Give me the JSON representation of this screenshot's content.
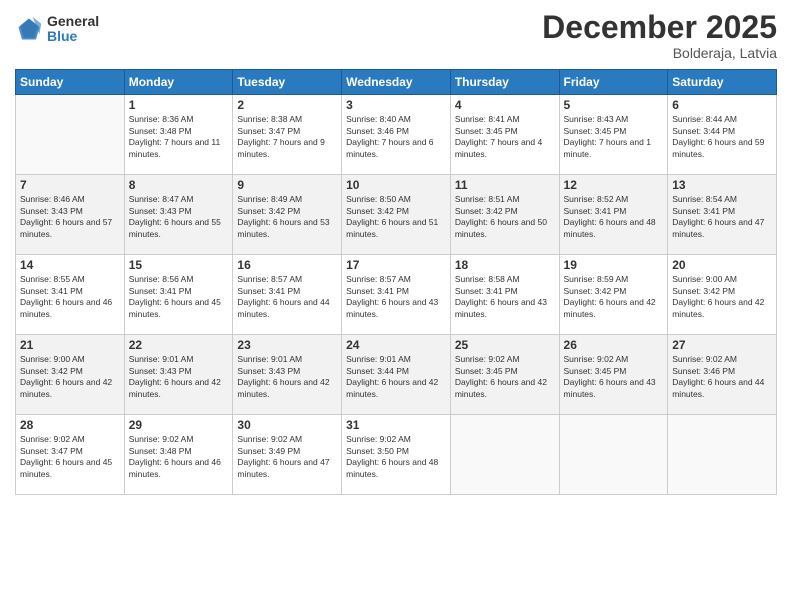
{
  "logo": {
    "general": "General",
    "blue": "Blue"
  },
  "title": "December 2025",
  "subtitle": "Bolderaja, Latvia",
  "headers": [
    "Sunday",
    "Monday",
    "Tuesday",
    "Wednesday",
    "Thursday",
    "Friday",
    "Saturday"
  ],
  "weeks": [
    [
      {
        "day": "",
        "sunrise": "",
        "sunset": "",
        "daylight": ""
      },
      {
        "day": "1",
        "sunrise": "Sunrise: 8:36 AM",
        "sunset": "Sunset: 3:48 PM",
        "daylight": "Daylight: 7 hours and 11 minutes."
      },
      {
        "day": "2",
        "sunrise": "Sunrise: 8:38 AM",
        "sunset": "Sunset: 3:47 PM",
        "daylight": "Daylight: 7 hours and 9 minutes."
      },
      {
        "day": "3",
        "sunrise": "Sunrise: 8:40 AM",
        "sunset": "Sunset: 3:46 PM",
        "daylight": "Daylight: 7 hours and 6 minutes."
      },
      {
        "day": "4",
        "sunrise": "Sunrise: 8:41 AM",
        "sunset": "Sunset: 3:45 PM",
        "daylight": "Daylight: 7 hours and 4 minutes."
      },
      {
        "day": "5",
        "sunrise": "Sunrise: 8:43 AM",
        "sunset": "Sunset: 3:45 PM",
        "daylight": "Daylight: 7 hours and 1 minute."
      },
      {
        "day": "6",
        "sunrise": "Sunrise: 8:44 AM",
        "sunset": "Sunset: 3:44 PM",
        "daylight": "Daylight: 6 hours and 59 minutes."
      }
    ],
    [
      {
        "day": "7",
        "sunrise": "Sunrise: 8:46 AM",
        "sunset": "Sunset: 3:43 PM",
        "daylight": "Daylight: 6 hours and 57 minutes."
      },
      {
        "day": "8",
        "sunrise": "Sunrise: 8:47 AM",
        "sunset": "Sunset: 3:43 PM",
        "daylight": "Daylight: 6 hours and 55 minutes."
      },
      {
        "day": "9",
        "sunrise": "Sunrise: 8:49 AM",
        "sunset": "Sunset: 3:42 PM",
        "daylight": "Daylight: 6 hours and 53 minutes."
      },
      {
        "day": "10",
        "sunrise": "Sunrise: 8:50 AM",
        "sunset": "Sunset: 3:42 PM",
        "daylight": "Daylight: 6 hours and 51 minutes."
      },
      {
        "day": "11",
        "sunrise": "Sunrise: 8:51 AM",
        "sunset": "Sunset: 3:42 PM",
        "daylight": "Daylight: 6 hours and 50 minutes."
      },
      {
        "day": "12",
        "sunrise": "Sunrise: 8:52 AM",
        "sunset": "Sunset: 3:41 PM",
        "daylight": "Daylight: 6 hours and 48 minutes."
      },
      {
        "day": "13",
        "sunrise": "Sunrise: 8:54 AM",
        "sunset": "Sunset: 3:41 PM",
        "daylight": "Daylight: 6 hours and 47 minutes."
      }
    ],
    [
      {
        "day": "14",
        "sunrise": "Sunrise: 8:55 AM",
        "sunset": "Sunset: 3:41 PM",
        "daylight": "Daylight: 6 hours and 46 minutes."
      },
      {
        "day": "15",
        "sunrise": "Sunrise: 8:56 AM",
        "sunset": "Sunset: 3:41 PM",
        "daylight": "Daylight: 6 hours and 45 minutes."
      },
      {
        "day": "16",
        "sunrise": "Sunrise: 8:57 AM",
        "sunset": "Sunset: 3:41 PM",
        "daylight": "Daylight: 6 hours and 44 minutes."
      },
      {
        "day": "17",
        "sunrise": "Sunrise: 8:57 AM",
        "sunset": "Sunset: 3:41 PM",
        "daylight": "Daylight: 6 hours and 43 minutes."
      },
      {
        "day": "18",
        "sunrise": "Sunrise: 8:58 AM",
        "sunset": "Sunset: 3:41 PM",
        "daylight": "Daylight: 6 hours and 43 minutes."
      },
      {
        "day": "19",
        "sunrise": "Sunrise: 8:59 AM",
        "sunset": "Sunset: 3:42 PM",
        "daylight": "Daylight: 6 hours and 42 minutes."
      },
      {
        "day": "20",
        "sunrise": "Sunrise: 9:00 AM",
        "sunset": "Sunset: 3:42 PM",
        "daylight": "Daylight: 6 hours and 42 minutes."
      }
    ],
    [
      {
        "day": "21",
        "sunrise": "Sunrise: 9:00 AM",
        "sunset": "Sunset: 3:42 PM",
        "daylight": "Daylight: 6 hours and 42 minutes."
      },
      {
        "day": "22",
        "sunrise": "Sunrise: 9:01 AM",
        "sunset": "Sunset: 3:43 PM",
        "daylight": "Daylight: 6 hours and 42 minutes."
      },
      {
        "day": "23",
        "sunrise": "Sunrise: 9:01 AM",
        "sunset": "Sunset: 3:43 PM",
        "daylight": "Daylight: 6 hours and 42 minutes."
      },
      {
        "day": "24",
        "sunrise": "Sunrise: 9:01 AM",
        "sunset": "Sunset: 3:44 PM",
        "daylight": "Daylight: 6 hours and 42 minutes."
      },
      {
        "day": "25",
        "sunrise": "Sunrise: 9:02 AM",
        "sunset": "Sunset: 3:45 PM",
        "daylight": "Daylight: 6 hours and 42 minutes."
      },
      {
        "day": "26",
        "sunrise": "Sunrise: 9:02 AM",
        "sunset": "Sunset: 3:45 PM",
        "daylight": "Daylight: 6 hours and 43 minutes."
      },
      {
        "day": "27",
        "sunrise": "Sunrise: 9:02 AM",
        "sunset": "Sunset: 3:46 PM",
        "daylight": "Daylight: 6 hours and 44 minutes."
      }
    ],
    [
      {
        "day": "28",
        "sunrise": "Sunrise: 9:02 AM",
        "sunset": "Sunset: 3:47 PM",
        "daylight": "Daylight: 6 hours and 45 minutes."
      },
      {
        "day": "29",
        "sunrise": "Sunrise: 9:02 AM",
        "sunset": "Sunset: 3:48 PM",
        "daylight": "Daylight: 6 hours and 46 minutes."
      },
      {
        "day": "30",
        "sunrise": "Sunrise: 9:02 AM",
        "sunset": "Sunset: 3:49 PM",
        "daylight": "Daylight: 6 hours and 47 minutes."
      },
      {
        "day": "31",
        "sunrise": "Sunrise: 9:02 AM",
        "sunset": "Sunset: 3:50 PM",
        "daylight": "Daylight: 6 hours and 48 minutes."
      },
      {
        "day": "",
        "sunrise": "",
        "sunset": "",
        "daylight": ""
      },
      {
        "day": "",
        "sunrise": "",
        "sunset": "",
        "daylight": ""
      },
      {
        "day": "",
        "sunrise": "",
        "sunset": "",
        "daylight": ""
      }
    ]
  ]
}
